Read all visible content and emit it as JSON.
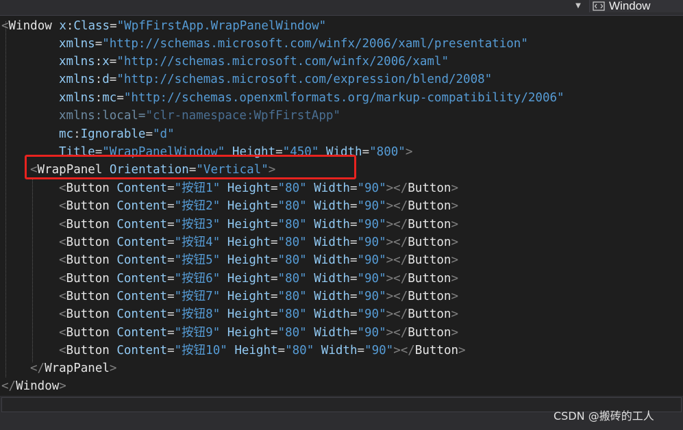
{
  "toolbar": {
    "element_selector": "Window"
  },
  "code": {
    "l1": {
      "open": "<",
      "tag": "Window",
      "a1": "x",
      "colon": ":",
      "a2": "Class",
      "eq": "=",
      "v": "\"WpfFirstApp.WrapPanelWindow\""
    },
    "l2": {
      "attr": "xmlns",
      "eq": "=",
      "v": "\"http://schemas.microsoft.com/winfx/2006/xaml/presentation\""
    },
    "l3": {
      "a1": "xmlns",
      "colon": ":",
      "a2": "x",
      "eq": "=",
      "v": "\"http://schemas.microsoft.com/winfx/2006/xaml\""
    },
    "l4": {
      "a1": "xmlns",
      "colon": ":",
      "a2": "d",
      "eq": "=",
      "v": "\"http://schemas.microsoft.com/expression/blend/2008\""
    },
    "l5": {
      "a1": "xmlns",
      "colon": ":",
      "a2": "mc",
      "eq": "=",
      "v": "\"http://schemas.openxmlformats.org/markup-compatibility/2006\""
    },
    "l6": {
      "a1": "xmlns",
      "colon": ":",
      "a2": "local",
      "eq": "=",
      "v": "\"clr-namespace:WpfFirstApp\""
    },
    "l7": {
      "a1": "mc",
      "colon": ":",
      "a2": "Ignorable",
      "eq": "=",
      "v": "\"d\""
    },
    "l8": {
      "a1": "Title",
      "eq1": "=",
      "v1": "\"WrapPanelWindow\"",
      "a2": "Height",
      "eq2": "=",
      "v2": "\"450\"",
      "a3": "Width",
      "eq3": "=",
      "v3": "\"800\"",
      "close": ">"
    },
    "l9": {
      "open": "<",
      "tag": "WrapPanel",
      "attr": "Orientation",
      "eq": "=",
      "v": "\"Vertical\"",
      "close": ">"
    },
    "buttons": [
      {
        "open": "<",
        "tag": "Button",
        "a1": "Content",
        "eq1": "=",
        "v1": "\"按钮1\"",
        "a2": "Height",
        "eq2": "=",
        "v2": "\"80\"",
        "a3": "Width",
        "eq3": "=",
        "v3": "\"90\"",
        "mid": "></",
        "ctag": "Button",
        "close": ">"
      },
      {
        "open": "<",
        "tag": "Button",
        "a1": "Content",
        "eq1": "=",
        "v1": "\"按钮2\"",
        "a2": "Height",
        "eq2": "=",
        "v2": "\"80\"",
        "a3": "Width",
        "eq3": "=",
        "v3": "\"90\"",
        "mid": "></",
        "ctag": "Button",
        "close": ">"
      },
      {
        "open": "<",
        "tag": "Button",
        "a1": "Content",
        "eq1": "=",
        "v1": "\"按钮3\"",
        "a2": "Height",
        "eq2": "=",
        "v2": "\"80\"",
        "a3": "Width",
        "eq3": "=",
        "v3": "\"90\"",
        "mid": "></",
        "ctag": "Button",
        "close": ">"
      },
      {
        "open": "<",
        "tag": "Button",
        "a1": "Content",
        "eq1": "=",
        "v1": "\"按钮4\"",
        "a2": "Height",
        "eq2": "=",
        "v2": "\"80\"",
        "a3": "Width",
        "eq3": "=",
        "v3": "\"90\"",
        "mid": "></",
        "ctag": "Button",
        "close": ">"
      },
      {
        "open": "<",
        "tag": "Button",
        "a1": "Content",
        "eq1": "=",
        "v1": "\"按钮5\"",
        "a2": "Height",
        "eq2": "=",
        "v2": "\"80\"",
        "a3": "Width",
        "eq3": "=",
        "v3": "\"90\"",
        "mid": "></",
        "ctag": "Button",
        "close": ">"
      },
      {
        "open": "<",
        "tag": "Button",
        "a1": "Content",
        "eq1": "=",
        "v1": "\"按钮6\"",
        "a2": "Height",
        "eq2": "=",
        "v2": "\"80\"",
        "a3": "Width",
        "eq3": "=",
        "v3": "\"90\"",
        "mid": "></",
        "ctag": "Button",
        "close": ">"
      },
      {
        "open": "<",
        "tag": "Button",
        "a1": "Content",
        "eq1": "=",
        "v1": "\"按钮7\"",
        "a2": "Height",
        "eq2": "=",
        "v2": "\"80\"",
        "a3": "Width",
        "eq3": "=",
        "v3": "\"90\"",
        "mid": "></",
        "ctag": "Button",
        "close": ">"
      },
      {
        "open": "<",
        "tag": "Button",
        "a1": "Content",
        "eq1": "=",
        "v1": "\"按钮8\"",
        "a2": "Height",
        "eq2": "=",
        "v2": "\"80\"",
        "a3": "Width",
        "eq3": "=",
        "v3": "\"90\"",
        "mid": "></",
        "ctag": "Button",
        "close": ">"
      },
      {
        "open": "<",
        "tag": "Button",
        "a1": "Content",
        "eq1": "=",
        "v1": "\"按钮9\"",
        "a2": "Height",
        "eq2": "=",
        "v2": "\"80\"",
        "a3": "Width",
        "eq3": "=",
        "v3": "\"90\"",
        "mid": "></",
        "ctag": "Button",
        "close": ">"
      },
      {
        "open": "<",
        "tag": "Button",
        "a1": "Content",
        "eq1": "=",
        "v1": "\"按钮10\"",
        "a2": "Height",
        "eq2": "=",
        "v2": "\"80\"",
        "a3": "Width",
        "eq3": "=",
        "v3": "\"90\"",
        "mid": "></",
        "ctag": "Button",
        "close": ">"
      }
    ],
    "l20": {
      "open": "</",
      "tag": "WrapPanel",
      "close": ">"
    },
    "l21": {
      "open": "</",
      "tag": "Window",
      "close": ">"
    }
  },
  "watermark": "CSDN @搬砖的工人",
  "colors": {
    "highlight_box": "#e8231f",
    "tag": "#e6e6e6",
    "attribute": "#92caf4",
    "value": "#569cd6",
    "bracket": "#808080",
    "background": "#1e1e1e"
  }
}
